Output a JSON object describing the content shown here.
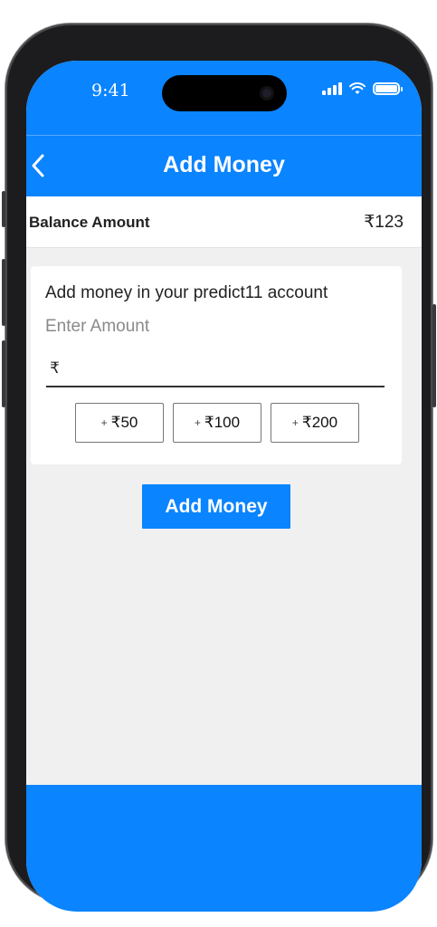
{
  "status_bar": {
    "time": "9:41"
  },
  "header": {
    "back_icon": "chevron-left-icon",
    "title": "Add Money"
  },
  "balance": {
    "label": "Balance Amount",
    "value": "₹123"
  },
  "add_money_card": {
    "title": "Add money in your predict11 account",
    "subtitle": "Enter Amount",
    "currency_symbol": "₹",
    "amount_value": "",
    "quick_amounts": [
      {
        "prefix": "+",
        "label": "₹50"
      },
      {
        "prefix": "+",
        "label": "₹100"
      },
      {
        "prefix": "+",
        "label": "₹200"
      }
    ]
  },
  "submit": {
    "label": "Add Money"
  },
  "colors": {
    "primary": "#0a84ff",
    "background": "#f0f0f0",
    "card": "#ffffff"
  }
}
